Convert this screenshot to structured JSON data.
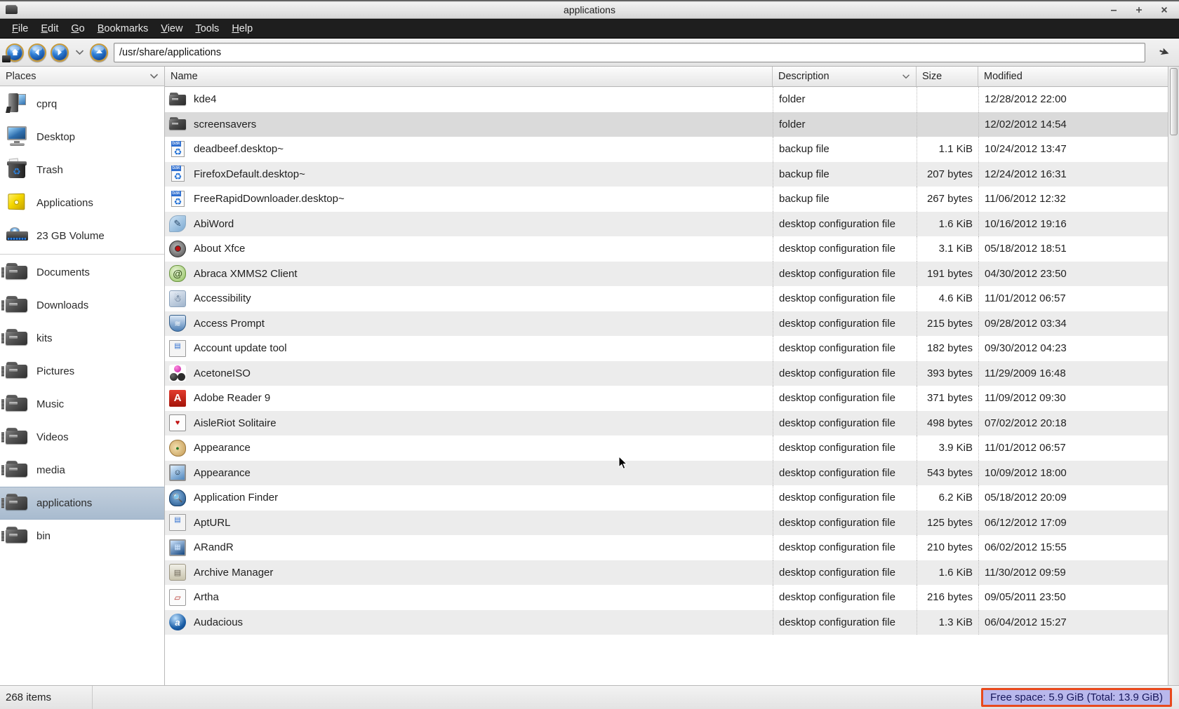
{
  "window": {
    "title": "applications",
    "icon": "file-manager-icon",
    "controls": {
      "minimize": "−",
      "maximize": "+",
      "close": "✕"
    }
  },
  "menubar": {
    "items": [
      {
        "label": "File",
        "accel": "F"
      },
      {
        "label": "Edit",
        "accel": "E"
      },
      {
        "label": "Go",
        "accel": "G"
      },
      {
        "label": "Bookmarks",
        "accel": "B"
      },
      {
        "label": "View",
        "accel": "V"
      },
      {
        "label": "Tools",
        "accel": "T"
      },
      {
        "label": "Help",
        "accel": "H"
      }
    ]
  },
  "toolbar": {
    "buttons": [
      {
        "name": "home-button",
        "icon": "home-icon"
      },
      {
        "name": "back-button",
        "icon": "arrow-left-icon"
      },
      {
        "name": "forward-button",
        "icon": "arrow-right-icon"
      },
      {
        "name": "history-dropdown",
        "icon": "chevron-down-icon"
      },
      {
        "name": "up-button",
        "icon": "arrow-up-icon"
      }
    ],
    "path_value": "/usr/share/applications",
    "end_icon": "pointer-arrow-icon"
  },
  "sidebar": {
    "header": "Places",
    "header_caret": "chevron-down-icon",
    "items": [
      {
        "label": "cprq",
        "icon": "computer-icon",
        "selected": false,
        "group": 1
      },
      {
        "label": "Desktop",
        "icon": "monitor-icon",
        "selected": false,
        "group": 1
      },
      {
        "label": "Trash",
        "icon": "trash-icon",
        "selected": false,
        "group": 1
      },
      {
        "label": "Applications",
        "icon": "applications-icon",
        "selected": false,
        "group": 1
      },
      {
        "label": "23 GB Volume",
        "icon": "drive-icon",
        "selected": false,
        "group": 1
      },
      {
        "label": "Documents",
        "icon": "folder-icon",
        "selected": false,
        "group": 2
      },
      {
        "label": "Downloads",
        "icon": "folder-icon",
        "selected": false,
        "group": 2
      },
      {
        "label": "kits",
        "icon": "folder-icon",
        "selected": false,
        "group": 2
      },
      {
        "label": "Pictures",
        "icon": "folder-icon",
        "selected": false,
        "group": 2
      },
      {
        "label": "Music",
        "icon": "folder-icon",
        "selected": false,
        "group": 2
      },
      {
        "label": "Videos",
        "icon": "folder-icon",
        "selected": false,
        "group": 2
      },
      {
        "label": "media",
        "icon": "folder-icon",
        "selected": false,
        "group": 2
      },
      {
        "label": "applications",
        "icon": "folder-icon",
        "selected": true,
        "group": 2
      },
      {
        "label": "bin",
        "icon": "folder-icon",
        "selected": false,
        "group": 2
      }
    ]
  },
  "filelist": {
    "columns": [
      {
        "key": "name",
        "label": "Name",
        "caret": ""
      },
      {
        "key": "description",
        "label": "Description",
        "caret": "chevron-down-icon"
      },
      {
        "key": "size",
        "label": "Size",
        "caret": ""
      },
      {
        "key": "modified",
        "label": "Modified",
        "caret": ""
      }
    ],
    "rows": [
      {
        "name": "kde4",
        "icon": "folder-icon",
        "description": "folder",
        "size": "",
        "modified": "12/28/2012 22:00",
        "highlight": false
      },
      {
        "name": "screensavers",
        "icon": "folder-icon",
        "description": "folder",
        "size": "",
        "modified": "12/02/2012 14:54",
        "highlight": true
      },
      {
        "name": "deadbeef.desktop~",
        "icon": "backup-file-icon",
        "description": "backup file",
        "size": "1.1 KiB",
        "modified": "10/24/2012 13:47",
        "highlight": false
      },
      {
        "name": "FirefoxDefault.desktop~",
        "icon": "backup-file-icon",
        "description": "backup file",
        "size": "207 bytes",
        "modified": "12/24/2012 16:31",
        "highlight": false
      },
      {
        "name": "FreeRapidDownloader.desktop~",
        "icon": "backup-file-icon",
        "description": "backup file",
        "size": "267 bytes",
        "modified": "11/06/2012 12:32",
        "highlight": false
      },
      {
        "name": "AbiWord",
        "icon": "abiword-icon",
        "description": "desktop configuration file",
        "size": "1.6 KiB",
        "modified": "10/16/2012 19:16",
        "highlight": false
      },
      {
        "name": "About Xfce",
        "icon": "gear-icon",
        "description": "desktop configuration file",
        "size": "3.1 KiB",
        "modified": "05/18/2012 18:51",
        "highlight": false
      },
      {
        "name": "Abraca XMMS2 Client",
        "icon": "abraca-icon",
        "description": "desktop configuration file",
        "size": "191 bytes",
        "modified": "04/30/2012 23:50",
        "highlight": false
      },
      {
        "name": "Accessibility",
        "icon": "accessibility-icon",
        "description": "desktop configuration file",
        "size": "4.6 KiB",
        "modified": "11/01/2012 06:57",
        "highlight": false
      },
      {
        "name": "Access Prompt",
        "icon": "shield-icon",
        "description": "desktop configuration file",
        "size": "215 bytes",
        "modified": "09/28/2012 03:34",
        "highlight": false
      },
      {
        "name": "Account update tool",
        "icon": "document-icon",
        "description": "desktop configuration file",
        "size": "182 bytes",
        "modified": "09/30/2012 04:23",
        "highlight": false
      },
      {
        "name": "AcetoneISO",
        "icon": "acetoneiso-icon",
        "description": "desktop configuration file",
        "size": "393 bytes",
        "modified": "11/29/2009 16:48",
        "highlight": false
      },
      {
        "name": "Adobe Reader 9",
        "icon": "pdf-icon",
        "description": "desktop configuration file",
        "size": "371 bytes",
        "modified": "11/09/2012 09:30",
        "highlight": false
      },
      {
        "name": "AisleRiot Solitaire",
        "icon": "cards-icon",
        "description": "desktop configuration file",
        "size": "498 bytes",
        "modified": "07/02/2012 20:18",
        "highlight": false
      },
      {
        "name": "Appearance",
        "icon": "palette-icon",
        "description": "desktop configuration file",
        "size": "3.9 KiB",
        "modified": "11/01/2012 06:57",
        "highlight": false
      },
      {
        "name": "Appearance",
        "icon": "xfce-display-icon",
        "description": "desktop configuration file",
        "size": "543 bytes",
        "modified": "10/09/2012 18:00",
        "highlight": false
      },
      {
        "name": "Application Finder",
        "icon": "finder-icon",
        "description": "desktop configuration file",
        "size": "6.2 KiB",
        "modified": "05/18/2012 20:09",
        "highlight": false
      },
      {
        "name": "AptURL",
        "icon": "document-icon",
        "description": "desktop configuration file",
        "size": "125 bytes",
        "modified": "06/12/2012 17:09",
        "highlight": false
      },
      {
        "name": "ARandR",
        "icon": "arandr-icon",
        "description": "desktop configuration file",
        "size": "210 bytes",
        "modified": "06/02/2012 15:55",
        "highlight": false
      },
      {
        "name": "Archive Manager",
        "icon": "archive-icon",
        "description": "desktop configuration file",
        "size": "1.6 KiB",
        "modified": "11/30/2012 09:59",
        "highlight": false
      },
      {
        "name": "Artha",
        "icon": "artha-icon",
        "description": "desktop configuration file",
        "size": "216 bytes",
        "modified": "09/05/2011 23:50",
        "highlight": false
      },
      {
        "name": "Audacious",
        "icon": "audacious-icon",
        "description": "desktop configuration file",
        "size": "1.3 KiB",
        "modified": "06/04/2012 15:27",
        "highlight": false
      }
    ]
  },
  "statusbar": {
    "item_count": "268 items",
    "free_space": "Free space: 5.9 GiB (Total: 13.9 GiB)",
    "free_space_border_color": "#e8491c",
    "free_space_background_color": "#b9b8ec"
  }
}
